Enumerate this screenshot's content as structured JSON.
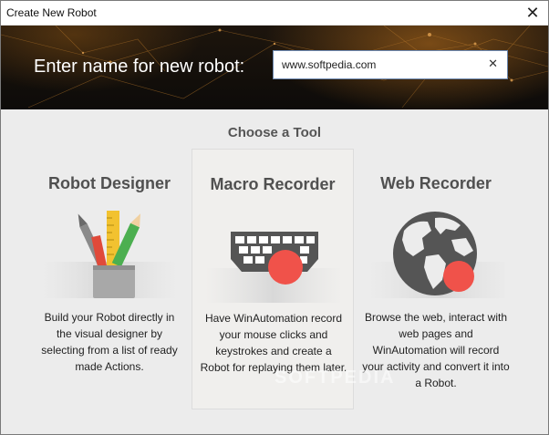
{
  "window": {
    "title": "Create New Robot",
    "close_symbol": "✕"
  },
  "header": {
    "prompt": "Enter name for new robot:",
    "name_value": "www.softpedia.com",
    "clear_symbol": "✕"
  },
  "section": {
    "heading": "Choose a Tool"
  },
  "tools": [
    {
      "title": "Robot Designer",
      "description": "Build your Robot directly in the visual designer by selecting from a list of ready made Actions.",
      "icon": "pencil-cup-icon",
      "selected": false
    },
    {
      "title": "Macro Recorder",
      "description": "Have WinAutomation record your mouse clicks and keystrokes and create a Robot for replaying them later.",
      "icon": "keyboard-record-icon",
      "selected": true
    },
    {
      "title": "Web Recorder",
      "description": "Browse the web, interact with web pages and WinAutomation will record your activity and convert it into a Robot.",
      "icon": "globe-record-icon",
      "selected": false
    }
  ],
  "watermark": "SOFTPEDIA",
  "colors": {
    "record_red": "#f0524a",
    "header_dark": "#0d0b09",
    "accent_orange": "#c8781e",
    "content_bg": "#ececec"
  }
}
